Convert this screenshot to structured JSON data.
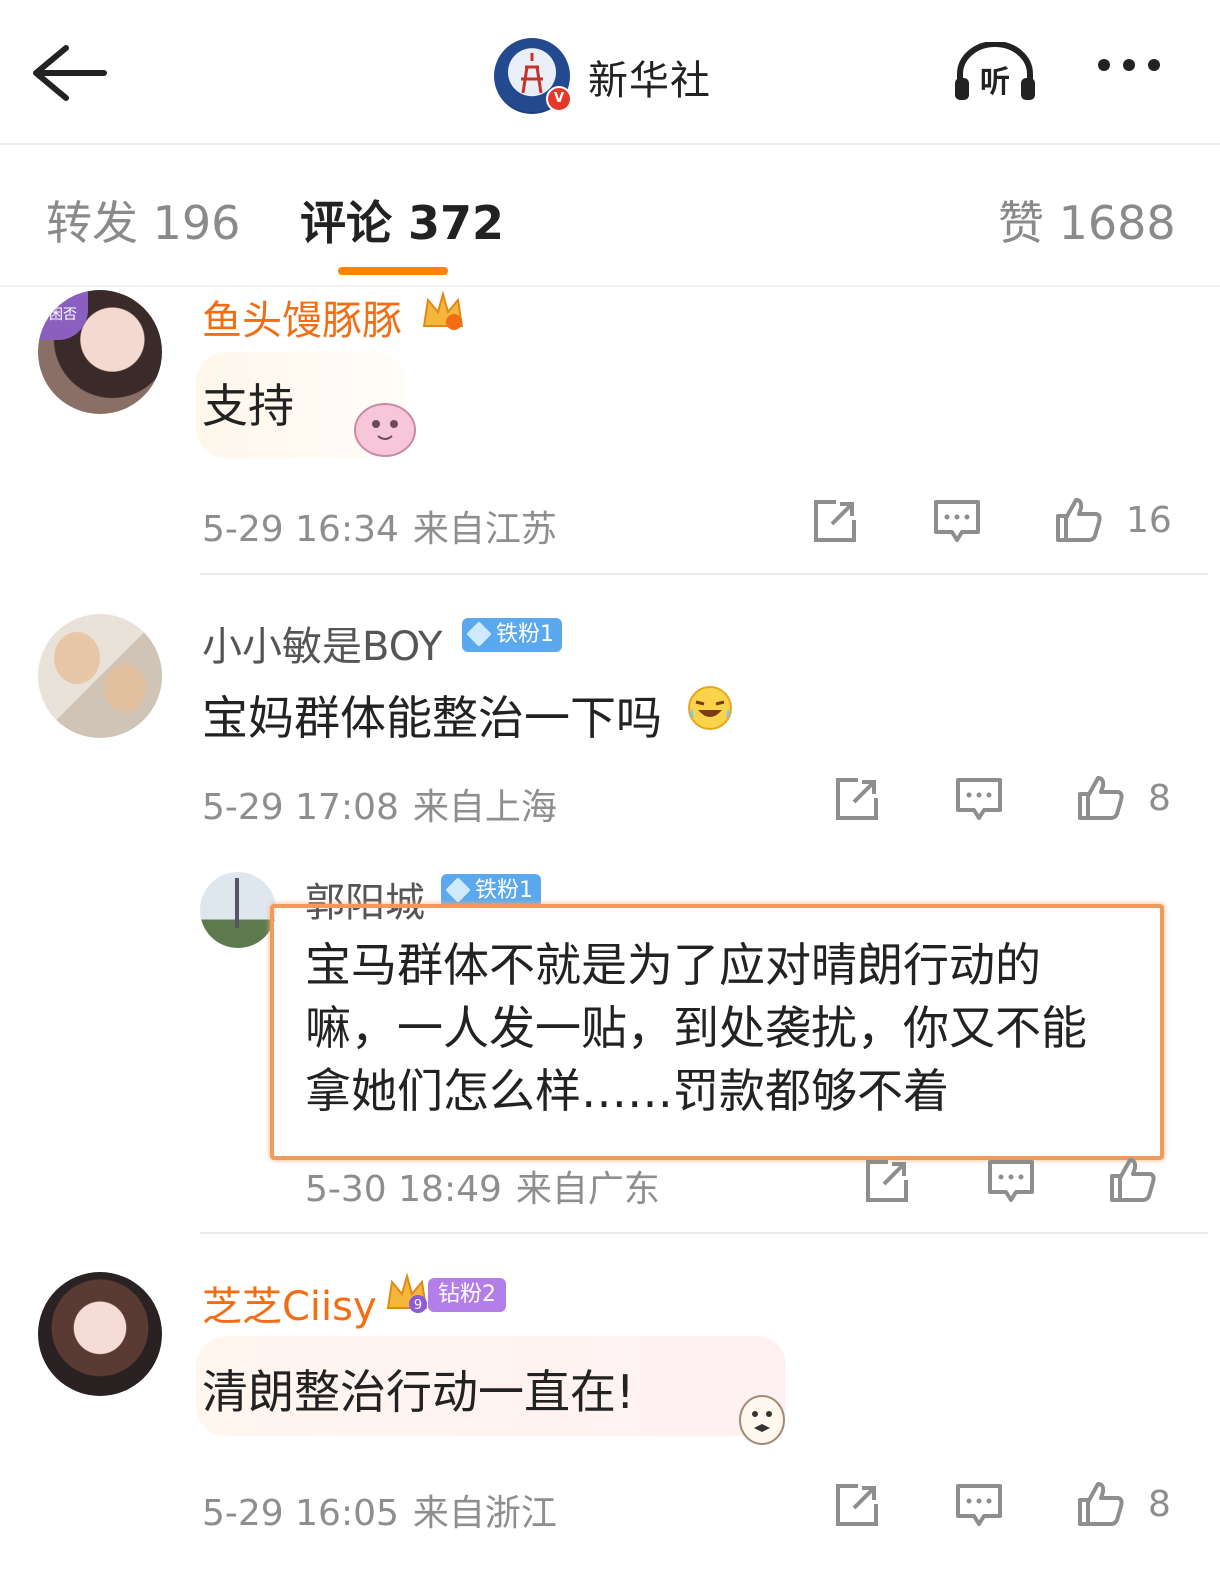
{
  "header": {
    "title": "新华社",
    "listen_label": "听",
    "logo_badge": "V"
  },
  "tabs": [
    {
      "label": "转发 196"
    },
    {
      "label": "评论 372"
    },
    {
      "label": "赞 1688"
    }
  ],
  "comments": [
    {
      "name": "鱼头馒豚豚",
      "avatar_tag": "困否",
      "text": "支持",
      "time": "5-29 16:34",
      "location": "来自江苏",
      "likes": "16"
    },
    {
      "name": "小小敏是BOY",
      "badge": "铁粉1",
      "text": "宝妈群体能整治一下吗",
      "time": "5-29 17:08",
      "location": "来自上海",
      "likes": "8"
    },
    {
      "name": "芝芝Ciisy",
      "badge": "钻粉2",
      "crown_level": "9",
      "text": "清朗整治行动一直在!",
      "time": "5-29 16:05",
      "location": "来自浙江",
      "likes": "8"
    }
  ],
  "reply": {
    "name": "郭阳城",
    "badge": "铁粉1",
    "text": "宝马群体不就是为了应对晴朗行动的\n嘛，一人发一贴，到处袭扰，你又不能\n拿她们怎么样……罚款都够不着",
    "time": "5-30 18:49",
    "location": "来自广东"
  },
  "colors": {
    "accent": "#ff8200",
    "vip_name": "#f26d13",
    "fan_badge": "#5aa8ee",
    "zuan_badge": "#b47ee8",
    "highlight_box": "#f29a5c"
  }
}
